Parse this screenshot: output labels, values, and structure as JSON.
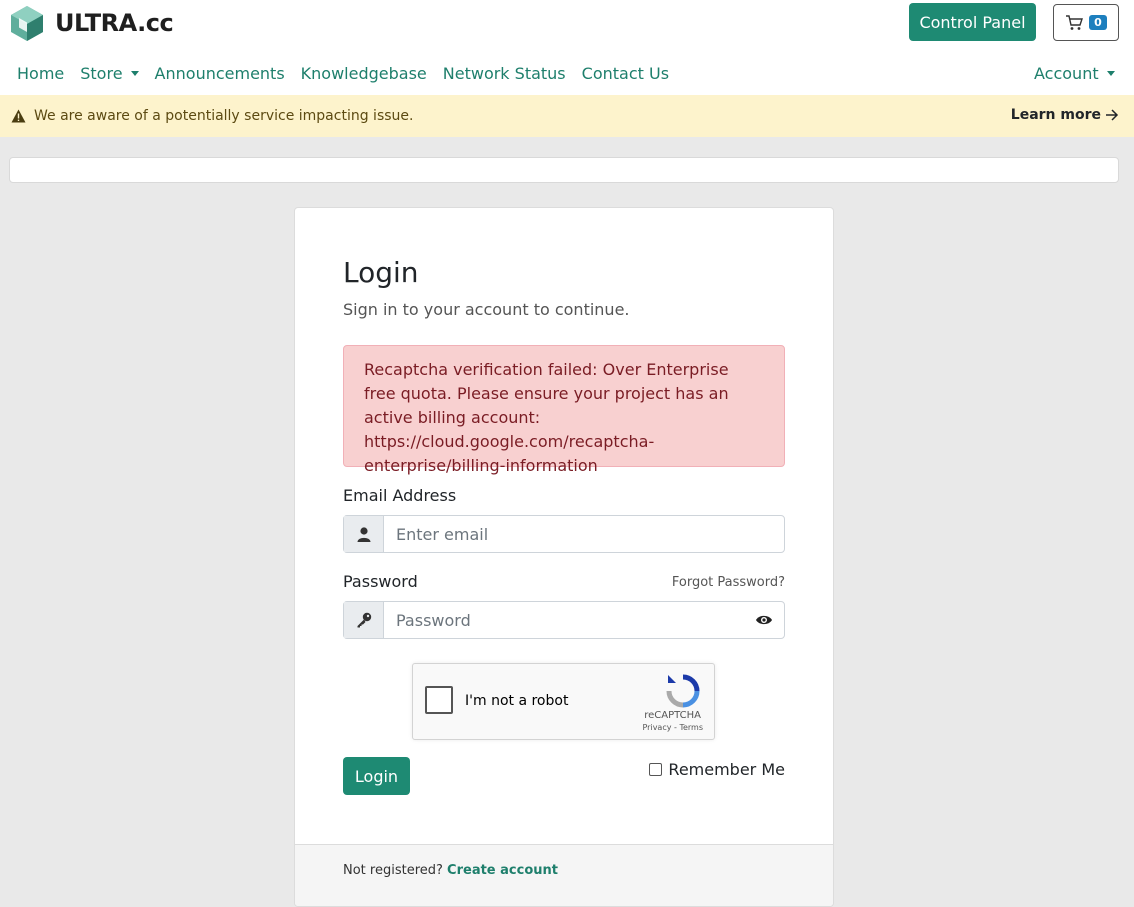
{
  "brand": {
    "name": "ULTRA.cc"
  },
  "header": {
    "control_panel_label": "Control Panel",
    "cart_count": "0",
    "account_label": "Account"
  },
  "nav": {
    "items": [
      {
        "label": "Home"
      },
      {
        "label": "Store",
        "dropdown": true
      },
      {
        "label": "Announcements"
      },
      {
        "label": "Knowledgebase"
      },
      {
        "label": "Network Status"
      },
      {
        "label": "Contact Us"
      }
    ]
  },
  "alert": {
    "message": "We are aware of a potentially service impacting issue.",
    "learn_more": "Learn more"
  },
  "login": {
    "title": "Login",
    "subtitle": "Sign in to your account to continue.",
    "error": "Recaptcha verification failed: Over Enterprise free quota. Please ensure your project has an active billing account: https://cloud.google.com/recaptcha-enterprise/billing-information",
    "email_label": "Email Address",
    "email_placeholder": "Enter email",
    "password_label": "Password",
    "password_placeholder": "Password",
    "forgot": "Forgot Password?",
    "captcha_label": "I'm not a robot",
    "captcha_brand": "reCAPTCHA",
    "captcha_links": "Privacy - Terms",
    "submit": "Login",
    "remember": "Remember Me",
    "not_registered": "Not registered?",
    "create_account": "Create account"
  },
  "colors": {
    "accent": "#1e8a73",
    "link": "#1e7f6c",
    "alert_bg": "#fdf3cc",
    "error_bg": "#f8d0d0"
  }
}
